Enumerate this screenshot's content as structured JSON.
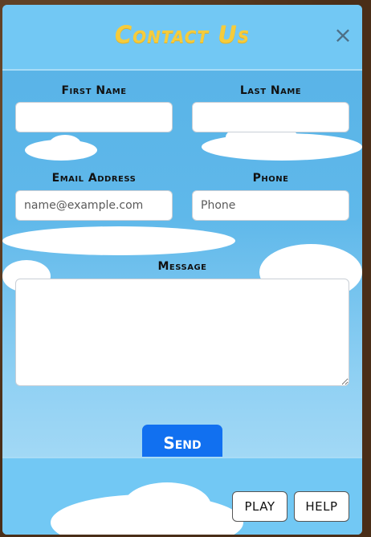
{
  "modal": {
    "title": "Contact Us",
    "close_glyph": "×"
  },
  "form": {
    "first_name_label": "First Name",
    "first_name_value": "",
    "last_name_label": "Last Name",
    "last_name_value": "",
    "email_label": "Email Address",
    "email_placeholder": "name@example.com",
    "phone_label": "Phone",
    "phone_placeholder": "Phone",
    "message_label": "Message",
    "message_value": "",
    "send_label": "Send"
  },
  "footer": {
    "play_label": "PLAY",
    "help_label": "HELP"
  },
  "colors": {
    "accent": "#1170f0",
    "title": "#f5cc3c",
    "header": "#72c8f4"
  }
}
